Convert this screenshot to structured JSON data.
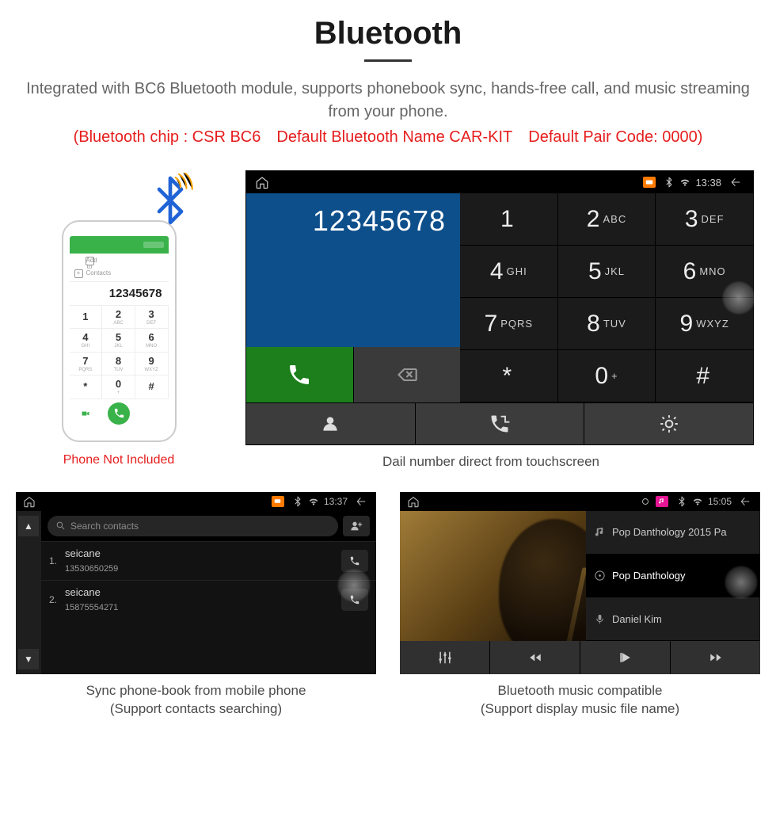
{
  "title": "Bluetooth",
  "subtitle": "Integrated with BC6 Bluetooth module, supports phonebook sync, hands-free call, and music streaming from your phone.",
  "redline": "(Bluetooth chip : CSR BC6 Default Bluetooth Name CAR-KIT Default Pair Code: 0000)",
  "phone": {
    "add_label": "Add to Contacts",
    "number": "12345678",
    "not_included": "Phone Not Included",
    "keys": [
      {
        "n": "1",
        "l": ""
      },
      {
        "n": "2",
        "l": "ABC"
      },
      {
        "n": "3",
        "l": "DEF"
      },
      {
        "n": "4",
        "l": "GHI"
      },
      {
        "n": "5",
        "l": "JKL"
      },
      {
        "n": "6",
        "l": "MNO"
      },
      {
        "n": "7",
        "l": "PQRS"
      },
      {
        "n": "8",
        "l": "TUV"
      },
      {
        "n": "9",
        "l": "WXYZ"
      },
      {
        "n": "*",
        "l": ""
      },
      {
        "n": "0",
        "l": "+"
      },
      {
        "n": "#",
        "l": ""
      }
    ]
  },
  "dialer": {
    "status_time": "13:38",
    "number": "12345678",
    "keys": [
      {
        "n": "1",
        "l": ""
      },
      {
        "n": "2",
        "l": "ABC"
      },
      {
        "n": "3",
        "l": "DEF"
      },
      {
        "n": "4",
        "l": "GHI"
      },
      {
        "n": "5",
        "l": "JKL"
      },
      {
        "n": "6",
        "l": "MNO"
      },
      {
        "n": "7",
        "l": "PQRS"
      },
      {
        "n": "8",
        "l": "TUV"
      },
      {
        "n": "9",
        "l": "WXYZ"
      },
      {
        "n": "*",
        "l": ""
      },
      {
        "n": "0",
        "l": "+"
      },
      {
        "n": "#",
        "l": ""
      }
    ],
    "caption": "Dail number direct from touchscreen"
  },
  "contacts": {
    "status_time": "13:37",
    "search_placeholder": "Search contacts",
    "rows": [
      {
        "idx": "1.",
        "name": "seicane",
        "phone": "13530650259"
      },
      {
        "idx": "2.",
        "name": "seicane",
        "phone": "15875554271"
      }
    ],
    "caption_line1": "Sync phone-book from mobile phone",
    "caption_line2": "(Support contacts searching)"
  },
  "music": {
    "status_time": "15:05",
    "tracks": [
      {
        "label": "Pop Danthology 2015 Pa"
      },
      {
        "label": "Pop Danthology"
      },
      {
        "label": "Daniel Kim"
      }
    ],
    "caption_line1": "Bluetooth music compatible",
    "caption_line2": "(Support display music file name)"
  }
}
